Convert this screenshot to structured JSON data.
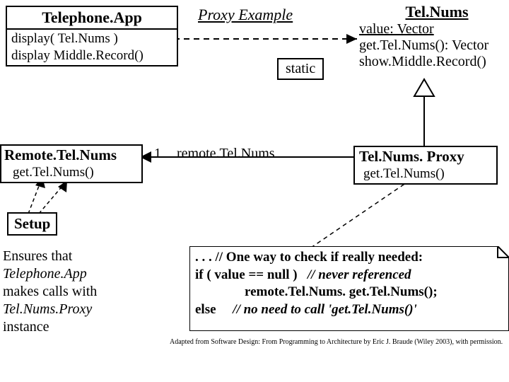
{
  "title": "Proxy Example",
  "classes": {
    "telephoneApp": {
      "name": "Telephone.App",
      "methods": [
        "display( Tel.Nums )",
        "display Middle.Record()"
      ]
    },
    "telNums": {
      "name": "Tel.Nums",
      "attrs": [
        "value: Vector"
      ],
      "methods": [
        "get.Tel.Nums(): Vector",
        "show.Middle.Record()"
      ]
    },
    "remoteTelNums": {
      "name": "Remote.Tel.Nums",
      "methods": [
        "get.Tel.Nums()"
      ]
    },
    "telNumsProxy": {
      "name": "Tel.Nums. Proxy",
      "methods": [
        "get.Tel.Nums()"
      ]
    },
    "setup": {
      "name": "Setup"
    }
  },
  "labels": {
    "static": "static",
    "mult": "1",
    "roleName": "remote.Tel.Nums"
  },
  "setupNote": {
    "line1": "Ensures that",
    "line2": "Telephone.App",
    "line3": "makes calls with",
    "line4": "Tel.Nums.Proxy",
    "line5": "instance"
  },
  "note": {
    "l1": ". . . // One way to check if really needed:",
    "l2a": "if ( value == null )",
    "l2b": "// never referenced",
    "l3": "remote.Tel.Nums. get.Tel.Nums();",
    "l4a": "else",
    "l4b": "// no need to call 'get.Tel.Nums()'"
  },
  "credit": "Adapted from Software Design: From Programming to Architecture by Eric J. Braude (Wiley 2003), with permission."
}
